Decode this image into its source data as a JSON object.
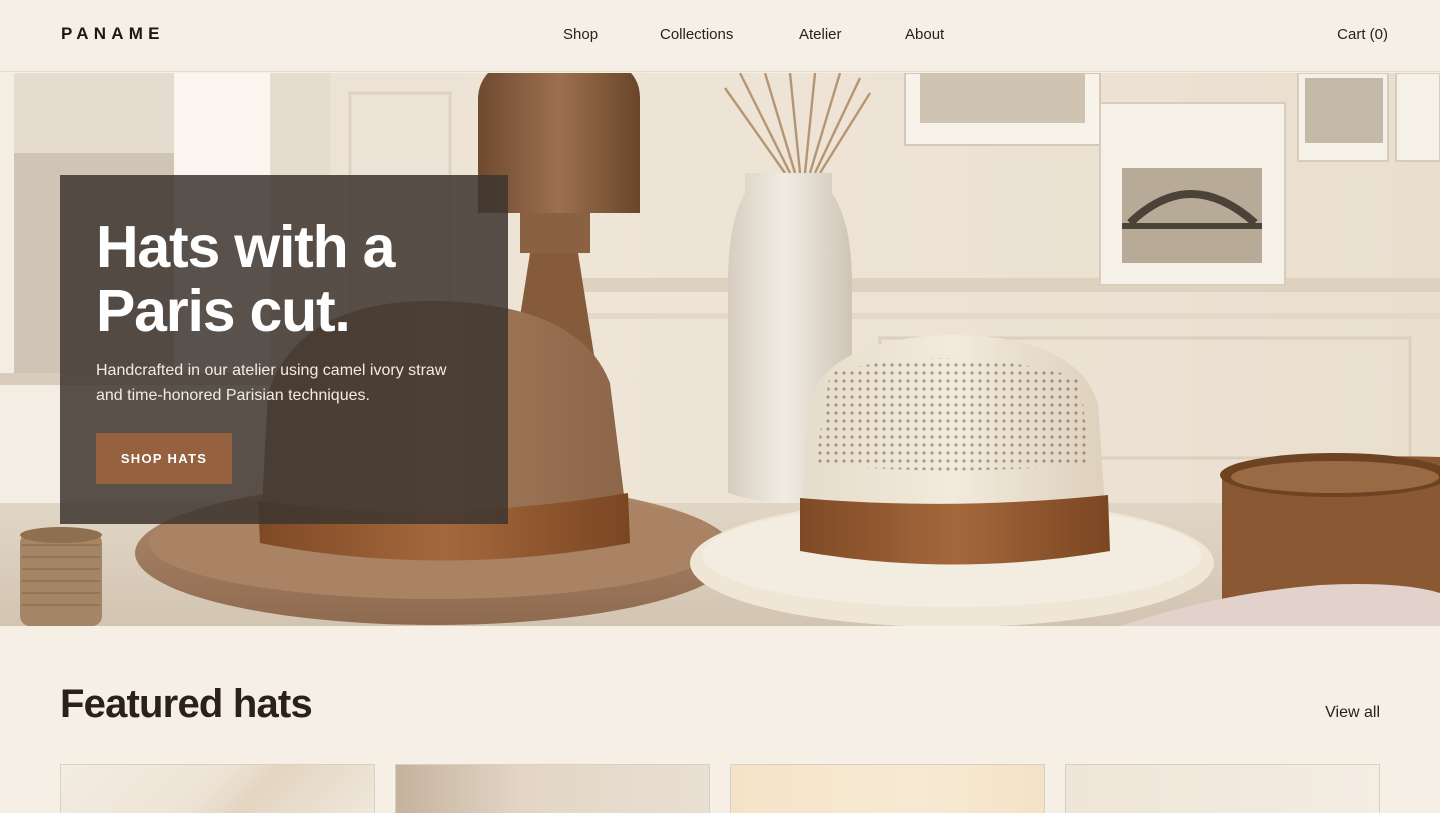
{
  "header": {
    "brand": "PANAME",
    "nav": [
      {
        "label": "Shop"
      },
      {
        "label": "Collections"
      },
      {
        "label": "Atelier"
      },
      {
        "label": "About"
      }
    ],
    "cart_label": "Cart (0)"
  },
  "hero": {
    "title": "Hats with a Paris cut.",
    "subtitle": "Handcrafted in our atelier using camel ivory straw and time-honored Parisian techniques.",
    "cta_label": "SHOP HATS",
    "image_alt_subject": "camel felt fedora and ivory straw hat on a table"
  },
  "featured": {
    "title": "Featured hats",
    "view_all_label": "View all",
    "products": [
      {
        "image": "hat-photo-1"
      },
      {
        "image": "hat-photo-2"
      },
      {
        "image": "hat-photo-3"
      },
      {
        "image": "hat-photo-4"
      }
    ]
  },
  "colors": {
    "background": "#f6efe5",
    "text": "#2a211c",
    "accent_button": "#96613f",
    "hero_card": "#3e3630"
  }
}
